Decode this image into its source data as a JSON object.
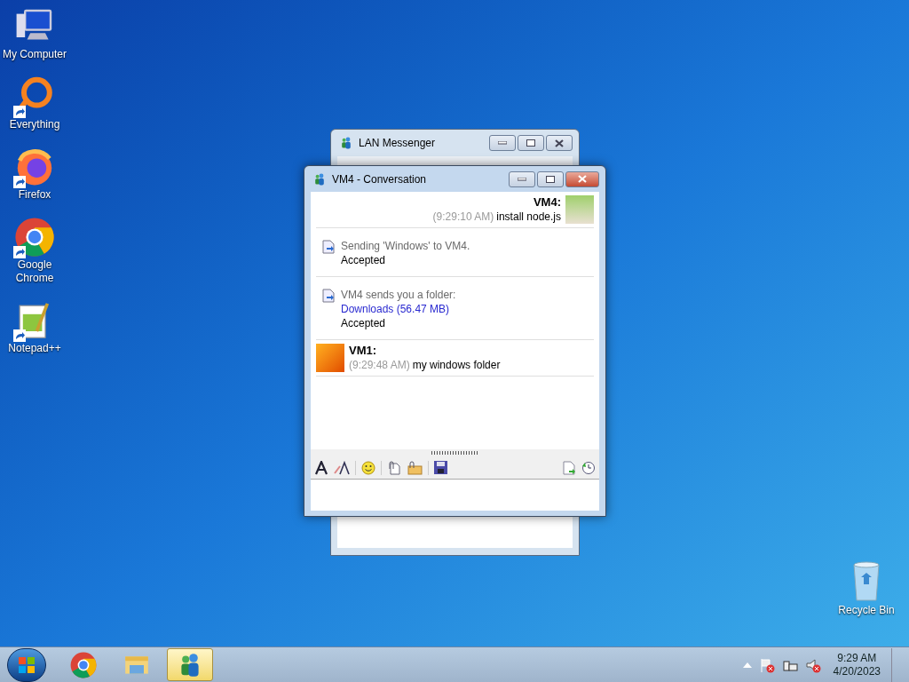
{
  "desktop_icons": [
    {
      "label": "My Computer",
      "kind": "computer"
    },
    {
      "label": "Everything",
      "kind": "ring"
    },
    {
      "label": "Firefox",
      "kind": "firefox"
    },
    {
      "label": "Google Chrome",
      "kind": "chrome"
    },
    {
      "label": "Notepad++",
      "kind": "notepad"
    }
  ],
  "recycle_bin": {
    "label": "Recycle Bin"
  },
  "background_window": {
    "title": "LAN Messenger"
  },
  "conversation": {
    "title": "VM4 - Conversation",
    "entries": [
      {
        "kind": "contact_message",
        "sender": "VM4:",
        "time": "(9:29:10 AM)",
        "text": "install node.js"
      },
      {
        "kind": "transfer",
        "lines": [
          {
            "text": "Sending 'Windows' to VM4.",
            "kind": "info"
          },
          {
            "text": "Accepted",
            "kind": "status"
          }
        ]
      },
      {
        "kind": "transfer",
        "lines": [
          {
            "text": "VM4 sends you a folder:",
            "kind": "info"
          },
          {
            "text": "Downloads (56.47 MB)",
            "kind": "link"
          },
          {
            "text": "Accepted",
            "kind": "status"
          }
        ]
      },
      {
        "kind": "own_message",
        "sender": "VM1:",
        "time": "(9:29:48 AM)",
        "text": "my windows folder"
      }
    ]
  },
  "taskbar": {
    "items": [
      {
        "kind": "chrome",
        "selected": false
      },
      {
        "kind": "explorer",
        "selected": false
      },
      {
        "kind": "messenger",
        "selected": true
      }
    ],
    "clock": {
      "time": "9:29 AM",
      "date": "4/20/2023"
    }
  }
}
